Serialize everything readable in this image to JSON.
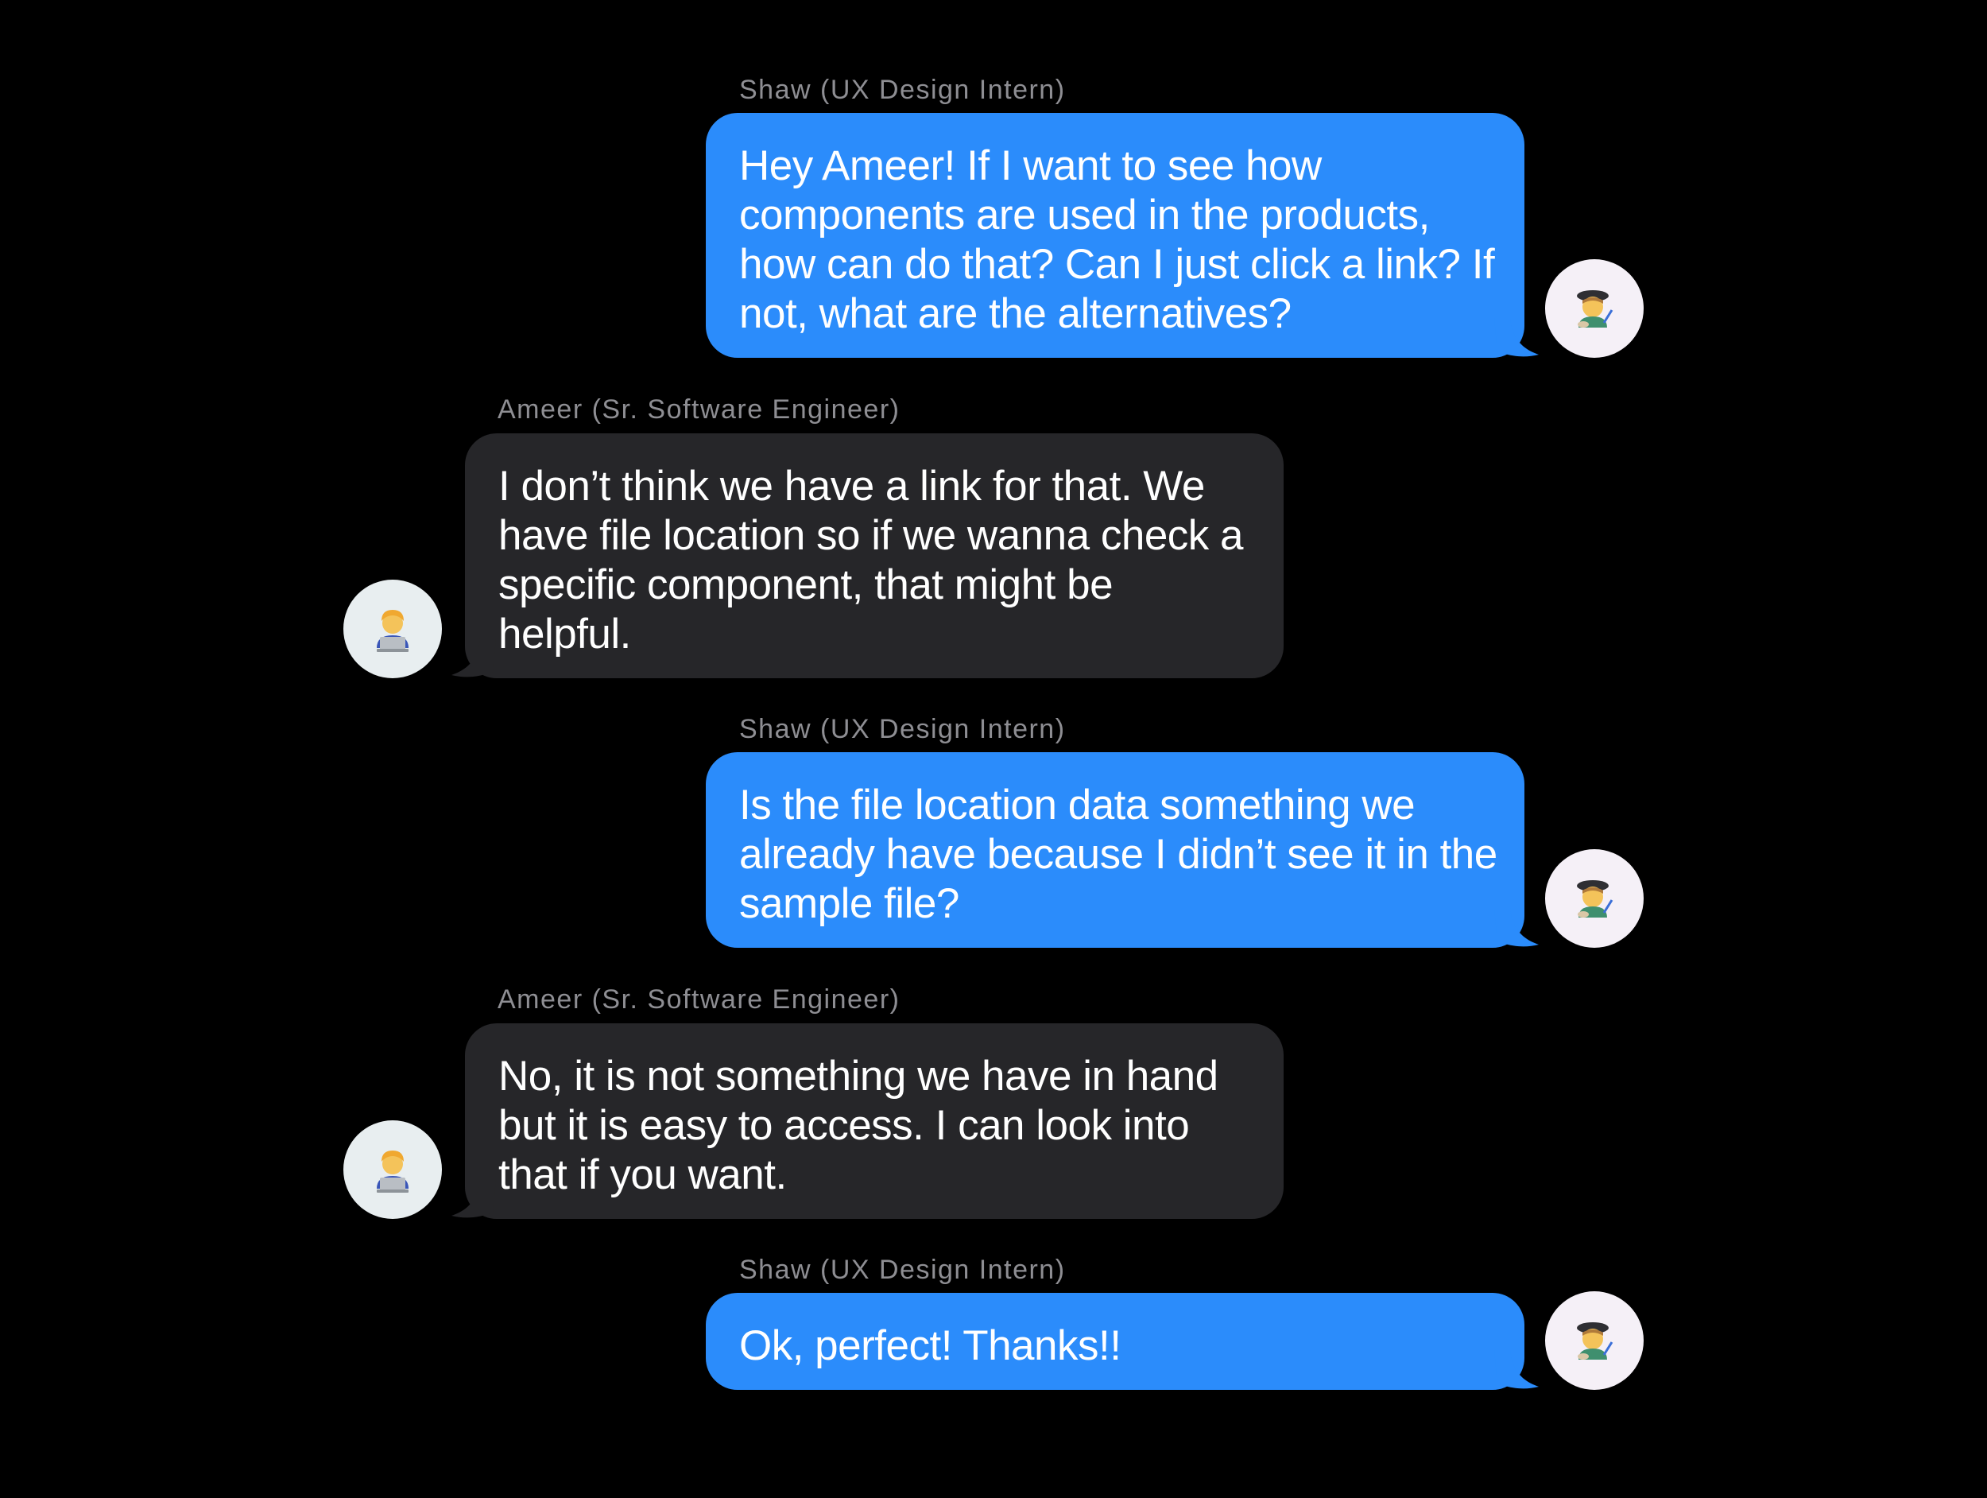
{
  "conversation": {
    "messages": [
      {
        "sender": "Shaw (UX Design Intern)",
        "lines": [
          "Hey Ameer! If I want to see how",
          "components are used in the products,",
          "how can do that? Can I just click a link? If",
          "not, what are the alternatives?"
        ]
      },
      {
        "sender": "Ameer (Sr. Software Engineer)",
        "lines": [
          "I don’t think we have a link for that. We",
          "have file location so if we wanna check a",
          "specific component, that might be",
          "helpful."
        ]
      },
      {
        "sender": "Shaw (UX Design Intern)",
        "lines": [
          "Is the file location data something we",
          "already have because I didn’t see it in the",
          "sample file?"
        ]
      },
      {
        "sender": "Ameer (Sr. Software Engineer)",
        "lines": [
          "No, it is not something we have in hand",
          "but it is easy to access. I can look into",
          "that if you want."
        ]
      },
      {
        "sender": "Shaw (UX Design Intern)",
        "lines": [
          "Ok, perfect! Thanks!!"
        ]
      }
    ]
  },
  "avatars": {
    "shaw": "artist-avatar-icon",
    "ameer": "technologist-avatar-icon"
  },
  "colors": {
    "background": "#000000",
    "outgoing_bubble": "#2b8cfb",
    "incoming_bubble": "#262629",
    "sender_label": "#8e8e93"
  }
}
